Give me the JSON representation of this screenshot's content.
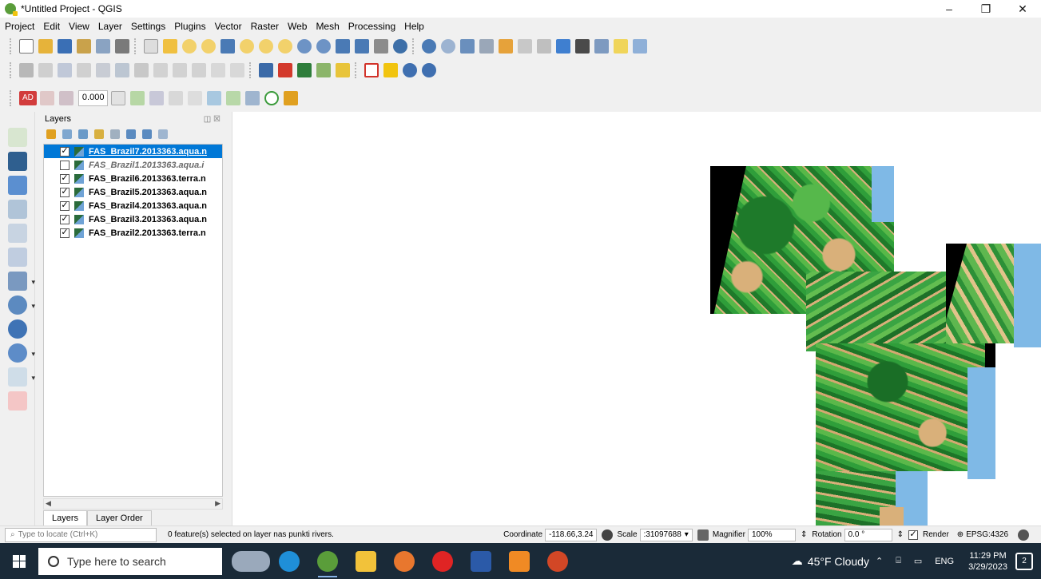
{
  "window": {
    "title": "*Untitled Project - QGIS",
    "minimize": "–",
    "maximize": "❐",
    "close": "✕"
  },
  "menu": [
    "Project",
    "Edit",
    "View",
    "Layer",
    "Settings",
    "Plugins",
    "Vector",
    "Raster",
    "Web",
    "Mesh",
    "Processing",
    "Help"
  ],
  "toolbar3": {
    "ad": "AD",
    "value": "0.000"
  },
  "layers_panel": {
    "title": "Layers",
    "items": [
      {
        "name": "FAS_Brazil7.2013363.aqua.n",
        "checked": true,
        "selected": true
      },
      {
        "name": "FAS_Brazil1.2013363.aqua.i",
        "checked": false,
        "selected": false
      },
      {
        "name": "FAS_Brazil6.2013363.terra.n",
        "checked": true,
        "selected": false
      },
      {
        "name": "FAS_Brazil5.2013363.aqua.n",
        "checked": true,
        "selected": false
      },
      {
        "name": "FAS_Brazil4.2013363.aqua.n",
        "checked": true,
        "selected": false
      },
      {
        "name": "FAS_Brazil3.2013363.aqua.n",
        "checked": true,
        "selected": false
      },
      {
        "name": "FAS_Brazil2.2013363.terra.n",
        "checked": true,
        "selected": false
      }
    ],
    "tabs": [
      "Layers",
      "Layer Order"
    ]
  },
  "status": {
    "locator_placeholder": "Type to locate (Ctrl+K)",
    "message": "0 feature(s) selected on layer nas punkti rivers.",
    "coordinate_label": "Coordinate",
    "coordinate_value": "-118.66,3.24",
    "scale_label": "Scale",
    "scale_value": ":31097688",
    "magnifier_label": "Magnifier",
    "magnifier_value": "100%",
    "rotation_label": "Rotation",
    "rotation_value": "0.0 °",
    "render_label": "Render",
    "crs": "EPSG:4326"
  },
  "taskbar": {
    "search_placeholder": "Type here to search",
    "weather": "45°F Cloudy",
    "lang": "ENG",
    "time": "11:29 PM",
    "date": "3/29/2023",
    "notifications": "2"
  },
  "colors": {
    "selection": "#0078d7",
    "taskbar": "#1a2a38",
    "map_green": "#2f9e3a",
    "map_water": "#7fb9e6",
    "map_tan": "#d9b07a"
  }
}
